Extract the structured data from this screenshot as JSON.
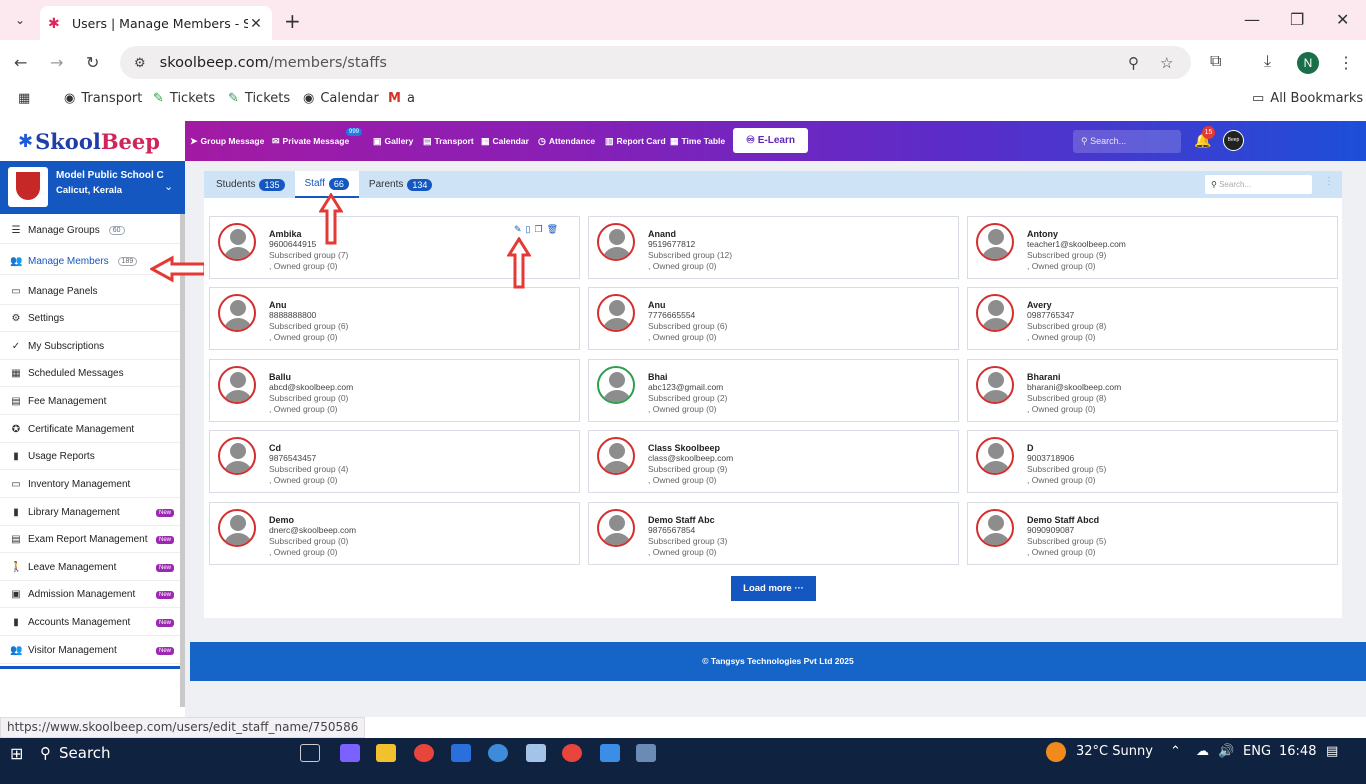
{
  "browser": {
    "tab_title": "Users | Manage Members - Staf",
    "url_host": "skoolbeep.com",
    "url_path": "/members/staffs",
    "bookmarks": [
      "Transport",
      "Tickets",
      "Tickets",
      "Calendar",
      "a"
    ],
    "all_bookmarks": "All Bookmarks",
    "profile_initial": "N",
    "status_url": "https://www.skoolbeep.com/users/edit_staff_name/750586"
  },
  "app": {
    "logo_a": "Skool",
    "logo_b": "Beep",
    "menu": [
      "Group Message",
      "Private Message",
      "Gallery",
      "Transport",
      "Calendar",
      "Attendance",
      "Report Card",
      "Time Table"
    ],
    "private_badge": "999",
    "elearn": "E-Learn",
    "search_placeholder": "Search...",
    "notif_count": "15",
    "user_label": "Beep"
  },
  "sidebar": {
    "school_name": "Model Public School C",
    "school_place": "Calicut, Kerala",
    "items": [
      {
        "label": "Manage Groups",
        "count": "60"
      },
      {
        "label": "Manage Members",
        "count": "189"
      },
      {
        "label": "Manage Panels"
      },
      {
        "label": "Settings"
      },
      {
        "label": "My Subscriptions"
      },
      {
        "label": "Scheduled Messages"
      },
      {
        "label": "Fee Management"
      },
      {
        "label": "Certificate Management"
      },
      {
        "label": "Usage Reports"
      },
      {
        "label": "Inventory Management"
      },
      {
        "label": "Library Management",
        "badge": "New"
      },
      {
        "label": "Exam Report Management",
        "badge": "New"
      },
      {
        "label": "Leave Management",
        "badge": "New"
      },
      {
        "label": "Admission Management",
        "badge": "New"
      },
      {
        "label": "Accounts Management",
        "badge": "New"
      },
      {
        "label": "Visitor Management",
        "badge": "New"
      }
    ]
  },
  "tabs": [
    {
      "label": "Students",
      "count": "135"
    },
    {
      "label": "Staff",
      "count": "66"
    },
    {
      "label": "Parents",
      "count": "134"
    }
  ],
  "content_search_placeholder": "Search...",
  "members": [
    {
      "name": "Ambika",
      "contact": "9600644915",
      "subscribed": "Subscribed group (7)",
      "owned": ", Owned group (0)"
    },
    {
      "name": "Anand",
      "contact": "9519677812",
      "subscribed": "Subscribed group (12)",
      "owned": ", Owned group (0)"
    },
    {
      "name": "Antony",
      "contact": "teacher1@skoolbeep.com",
      "subscribed": "Subscribed group (9)",
      "owned": ", Owned group (0)"
    },
    {
      "name": "Anu",
      "contact": "8888888800",
      "subscribed": "Subscribed group (6)",
      "owned": ", Owned group (0)"
    },
    {
      "name": "Anu",
      "contact": "7776665554",
      "subscribed": "Subscribed group (6)",
      "owned": ", Owned group (0)"
    },
    {
      "name": "Avery",
      "contact": "0987765347",
      "subscribed": "Subscribed group (8)",
      "owned": ", Owned group (0)"
    },
    {
      "name": "Ballu",
      "contact": "abcd@skoolbeep.com",
      "subscribed": "Subscribed group (0)",
      "owned": ", Owned group (0)"
    },
    {
      "name": "Bhai",
      "contact": "abc123@gmail.com",
      "subscribed": "Subscribed group (2)",
      "owned": ", Owned group (0)"
    },
    {
      "name": "Bharani",
      "contact": "bharani@skoolbeep.com",
      "subscribed": "Subscribed group (8)",
      "owned": ", Owned group (0)"
    },
    {
      "name": "Cd",
      "contact": "9876543457",
      "subscribed": "Subscribed group (4)",
      "owned": ", Owned group (0)"
    },
    {
      "name": "Class Skoolbeep",
      "contact": "class@skoolbeep.com",
      "subscribed": "Subscribed group (9)",
      "owned": ", Owned group (0)"
    },
    {
      "name": "D",
      "contact": "9003718906",
      "subscribed": "Subscribed group (5)",
      "owned": ", Owned group (0)"
    },
    {
      "name": "Demo",
      "contact": "dnerc@skoolbeep.com",
      "subscribed": "Subscribed group (0)",
      "owned": ", Owned group (0)"
    },
    {
      "name": "Demo Staff Abc",
      "contact": "9876567854",
      "subscribed": "Subscribed group (3)",
      "owned": ", Owned group (0)"
    },
    {
      "name": "Demo Staff Abcd",
      "contact": "9090909087",
      "subscribed": "Subscribed group (5)",
      "owned": ", Owned group (0)"
    }
  ],
  "load_more": "Load more ···",
  "footer": "© Tangsys Technologies Pvt Ltd 2025",
  "taskbar": {
    "search": "Search",
    "weather": "32°C  Sunny",
    "lang": "ENG",
    "time": "16:48"
  },
  "colors": {
    "primary": "#1557c0",
    "annotation": "#e53935",
    "avatar_ring": "#d32f2f"
  }
}
